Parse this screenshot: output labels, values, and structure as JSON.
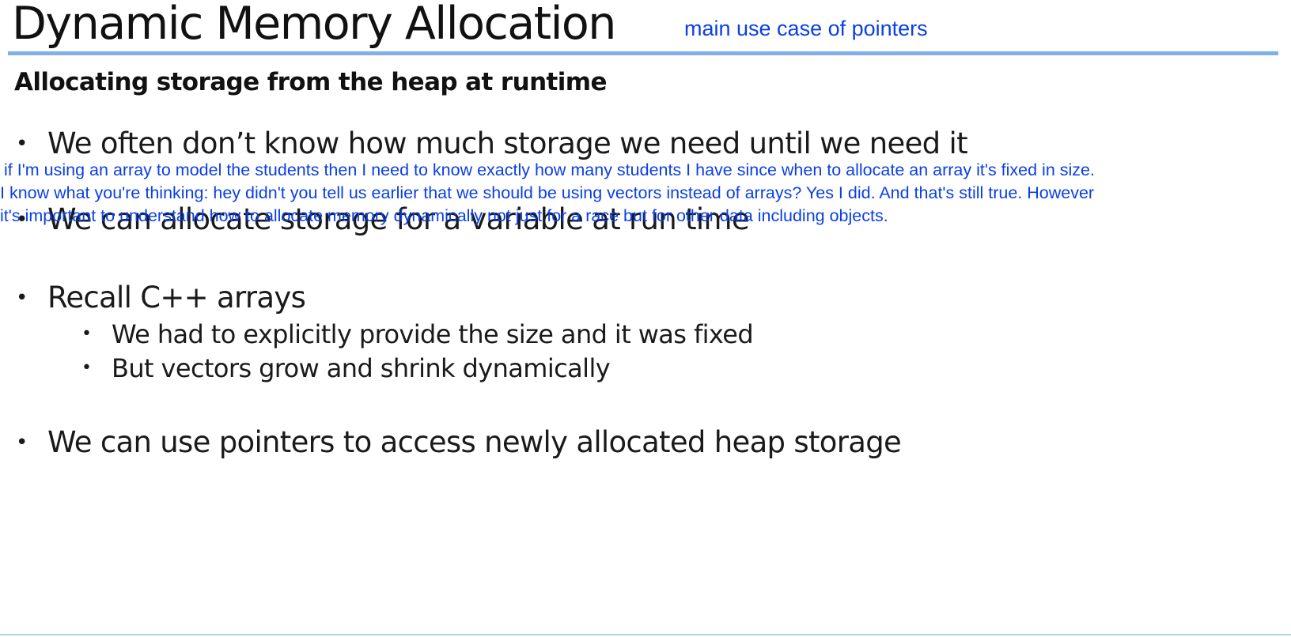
{
  "slide": {
    "title": "Dynamic Memory Allocation",
    "subtitle": "Allocating storage from the heap at runtime",
    "bullets": [
      "We often don’t know how much storage we need until we need it",
      "We can allocate storage for a variable at run time",
      "Recall C++ arrays",
      "We had to explicitly provide the size and it was fixed",
      "But vectors grow and shrink dynamically",
      "We can use pointers to access newly allocated heap storage"
    ],
    "bullet_symbol": "•"
  },
  "annotations": {
    "side_note": "main use case of pointers",
    "caption_lines": [
      "if I'm using an array to model the students then I need to know exactly how many students I have since when to allocate an array it's fixed in size.",
      "I know what you're thinking: hey didn't you tell us earlier that we should be using vectors instead of arrays? Yes I did. And that's still true. However",
      "it's important to understand how to allocate memory dynamically not just for a race but for other data including objects."
    ]
  },
  "colors": {
    "annotation_text": "#0a3fe8",
    "title_rule": "#7fb1e6",
    "bottom_rule": "#a9d3ee"
  }
}
